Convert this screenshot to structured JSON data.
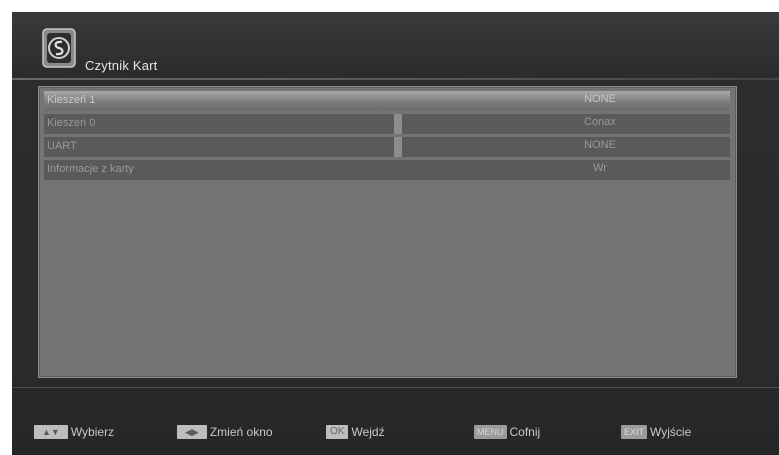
{
  "header": {
    "title": "Czytnik Kart",
    "logo": "card-reader-logo-icon"
  },
  "rows": [
    {
      "label": "Kieszeń 1",
      "value": "NONE",
      "selected": true
    },
    {
      "label": "Kieszeń 0",
      "value": "Conax",
      "selected": false
    },
    {
      "label": "UART",
      "value": "NONE",
      "selected": false
    },
    {
      "label": "Informacje z karty",
      "value": "Wr",
      "selected": false
    }
  ],
  "footer": {
    "hints": [
      {
        "key": "up-down-arrows-icon",
        "label": "Wybierz"
      },
      {
        "key": "left-right-arrows-icon",
        "label": "Zmień okno"
      },
      {
        "key_text": "OK",
        "label": "Wejdź"
      },
      {
        "key_text": "MENU",
        "label": "Cofnij"
      },
      {
        "key_text": "EXIT",
        "label": "Wyjście"
      }
    ]
  }
}
